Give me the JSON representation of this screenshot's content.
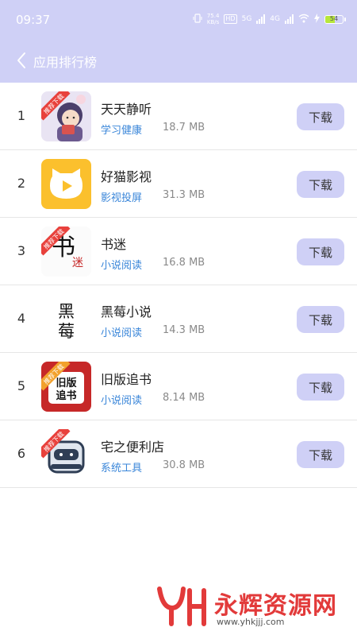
{
  "status_bar": {
    "time": "09:37",
    "net_speed_value": "75.4",
    "net_speed_unit": "KB/s",
    "hd_label": "HD",
    "signal_5g": "5G",
    "signal_4g": "4G",
    "battery_level": "54"
  },
  "header": {
    "back_icon": "chevron-left-icon",
    "title": "应用排行榜"
  },
  "apps": [
    {
      "rank": "1",
      "name": "天天静听",
      "category": "学习健康",
      "size": "18.7 MB",
      "button": "下载"
    },
    {
      "rank": "2",
      "name": "好猫影视",
      "category": "影视投屏",
      "size": "31.3 MB",
      "button": "下载"
    },
    {
      "rank": "3",
      "name": "书迷",
      "category": "小说阅读",
      "size": "16.8 MB",
      "button": "下载"
    },
    {
      "rank": "4",
      "name": "黑莓小说",
      "category": "小说阅读",
      "size": "14.3 MB",
      "button": "下载"
    },
    {
      "rank": "5",
      "name": "旧版追书",
      "category": "小说阅读",
      "size": "8.14 MB",
      "button": "下载"
    },
    {
      "rank": "6",
      "name": "宅之便利店",
      "category": "系统工具",
      "size": "30.8 MB",
      "button": "下载"
    }
  ],
  "icon_badges": {
    "recommend": "推荐下载",
    "shumi_glyph_1": "书",
    "shumi_glyph_2": "迷",
    "heimei_glyph_1": "黑",
    "heimei_glyph_2": "莓",
    "zhuishu_line1": "旧版",
    "zhuishu_line2": "追书"
  },
  "watermark": {
    "brand": "永辉资源网",
    "url": "www.yhkjjj.com"
  },
  "colors": {
    "header_bg": "#cfd0f6",
    "button_bg": "#cfd0f6",
    "category_text": "#3a86d9",
    "watermark": "#e23a3a"
  }
}
